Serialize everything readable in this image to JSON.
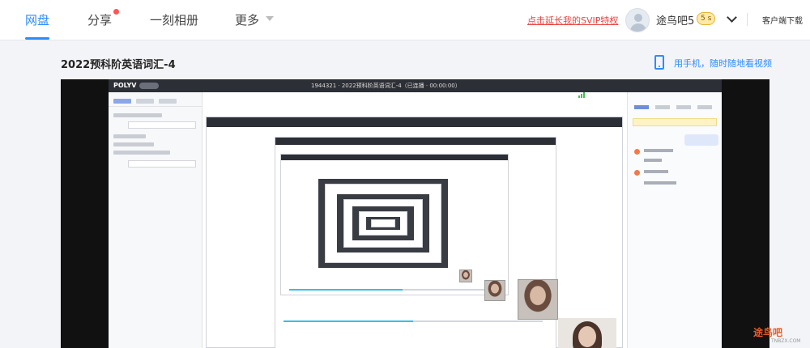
{
  "nav": {
    "items": [
      {
        "label": "网盘"
      },
      {
        "label": "分享"
      },
      {
        "label": "一刻相册"
      },
      {
        "label": "更多"
      }
    ],
    "active_index": 0,
    "promo_text": "点击延长我的SVIP特权",
    "username": "途鸟吧5",
    "vip_badge": "5 s",
    "client_download": "客户端下载"
  },
  "page": {
    "title": "2022预科阶英语词汇-4",
    "mobile_link": "用手机，随时随地看视频"
  },
  "player": {
    "brand": "POLYV",
    "screen_title": "1944321 · 2022预科阶英语词汇-4（已连播 · 00:00:00）"
  },
  "watermark": {
    "text": "途鸟吧",
    "sub": "TNBZX.COM"
  },
  "colors": {
    "accent": "#2b8cff",
    "promo": "#e8423f",
    "player_bg": "#111111",
    "progress": "#32c0e8"
  },
  "icons": {
    "avatar": "user-avatar-icon",
    "dropdown": "chevron-down-icon",
    "phone": "mobile-phone-icon"
  }
}
